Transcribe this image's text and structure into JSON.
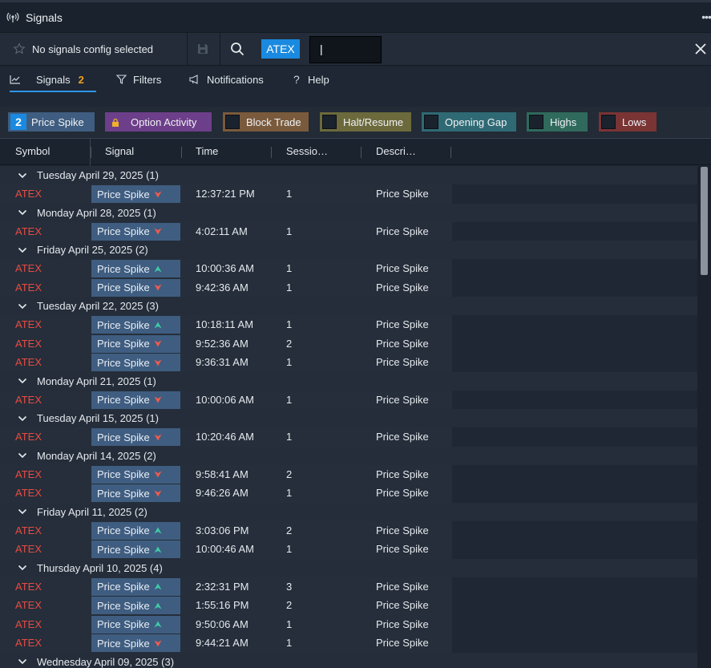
{
  "window": {
    "title": "Signals"
  },
  "toolbar": {
    "config_label": "No signals config selected",
    "symbol": "ATEX",
    "symbol_input_value": "|"
  },
  "tabs": [
    {
      "label": "Signals",
      "badge": "2"
    },
    {
      "label": "Filters"
    },
    {
      "label": "Notifications"
    },
    {
      "label": "Help"
    }
  ],
  "chips": [
    {
      "label": "Price Spike",
      "count": "2",
      "color": "#3f5d80"
    },
    {
      "label": "Option Activity",
      "color": "#6d3f8a"
    },
    {
      "label": "Block Trade",
      "color": "#7a5a3c"
    },
    {
      "label": "Halt/Resume",
      "color": "#6c6a3c"
    },
    {
      "label": "Opening Gap",
      "color": "#2f6a74"
    },
    {
      "label": "Highs",
      "color": "#2f6a5c"
    },
    {
      "label": "Lows",
      "color": "#7a3434"
    }
  ],
  "columns": [
    "Symbol",
    "Signal",
    "Time",
    "Sessio…",
    "Descri…"
  ],
  "groups": [
    {
      "label": "Tuesday April 29, 2025 (1)",
      "rows": [
        {
          "symbol": "ATEX",
          "signal": "Price Spike",
          "dir": "down",
          "time": "12:37:21 PM",
          "session": "1",
          "desc": "Price Spike"
        }
      ]
    },
    {
      "label": "Monday April 28, 2025 (1)",
      "rows": [
        {
          "symbol": "ATEX",
          "signal": "Price Spike",
          "dir": "down",
          "time": "4:02:11 AM",
          "session": "1",
          "desc": "Price Spike"
        }
      ]
    },
    {
      "label": "Friday April 25, 2025 (2)",
      "rows": [
        {
          "symbol": "ATEX",
          "signal": "Price Spike",
          "dir": "up",
          "time": "10:00:36 AM",
          "session": "1",
          "desc": "Price Spike"
        },
        {
          "symbol": "ATEX",
          "signal": "Price Spike",
          "dir": "down",
          "time": "9:42:36 AM",
          "session": "1",
          "desc": "Price Spike"
        }
      ]
    },
    {
      "label": "Tuesday April 22, 2025 (3)",
      "rows": [
        {
          "symbol": "ATEX",
          "signal": "Price Spike",
          "dir": "up",
          "time": "10:18:11 AM",
          "session": "1",
          "desc": "Price Spike"
        },
        {
          "symbol": "ATEX",
          "signal": "Price Spike",
          "dir": "down",
          "time": "9:52:36 AM",
          "session": "2",
          "desc": "Price Spike"
        },
        {
          "symbol": "ATEX",
          "signal": "Price Spike",
          "dir": "down",
          "time": "9:36:31 AM",
          "session": "1",
          "desc": "Price Spike"
        }
      ]
    },
    {
      "label": "Monday April 21, 2025 (1)",
      "rows": [
        {
          "symbol": "ATEX",
          "signal": "Price Spike",
          "dir": "down",
          "time": "10:00:06 AM",
          "session": "1",
          "desc": "Price Spike"
        }
      ]
    },
    {
      "label": "Tuesday April 15, 2025 (1)",
      "rows": [
        {
          "symbol": "ATEX",
          "signal": "Price Spike",
          "dir": "down",
          "time": "10:20:46 AM",
          "session": "1",
          "desc": "Price Spike"
        }
      ]
    },
    {
      "label": "Monday April 14, 2025 (2)",
      "rows": [
        {
          "symbol": "ATEX",
          "signal": "Price Spike",
          "dir": "down",
          "time": "9:58:41 AM",
          "session": "2",
          "desc": "Price Spike"
        },
        {
          "symbol": "ATEX",
          "signal": "Price Spike",
          "dir": "down",
          "time": "9:46:26 AM",
          "session": "1",
          "desc": "Price Spike"
        }
      ]
    },
    {
      "label": "Friday April 11, 2025 (2)",
      "rows": [
        {
          "symbol": "ATEX",
          "signal": "Price Spike",
          "dir": "up",
          "time": "3:03:06 PM",
          "session": "2",
          "desc": "Price Spike"
        },
        {
          "symbol": "ATEX",
          "signal": "Price Spike",
          "dir": "up",
          "time": "10:00:46 AM",
          "session": "1",
          "desc": "Price Spike"
        }
      ]
    },
    {
      "label": "Thursday April 10, 2025 (4)",
      "rows": [
        {
          "symbol": "ATEX",
          "signal": "Price Spike",
          "dir": "up",
          "time": "2:32:31 PM",
          "session": "3",
          "desc": "Price Spike"
        },
        {
          "symbol": "ATEX",
          "signal": "Price Spike",
          "dir": "up",
          "time": "1:55:16 PM",
          "session": "2",
          "desc": "Price Spike"
        },
        {
          "symbol": "ATEX",
          "signal": "Price Spike",
          "dir": "up",
          "time": "9:50:06 AM",
          "session": "1",
          "desc": "Price Spike"
        },
        {
          "symbol": "ATEX",
          "signal": "Price Spike",
          "dir": "down",
          "time": "9:44:21 AM",
          "session": "1",
          "desc": "Price Spike"
        }
      ]
    },
    {
      "label": "Wednesday April 09, 2025 (3)",
      "rows": []
    }
  ],
  "colors": {
    "symbol": "#e84b43",
    "up": "#3fc9a8",
    "down": "#ef5b4f",
    "accent": "#1a8ae0"
  }
}
